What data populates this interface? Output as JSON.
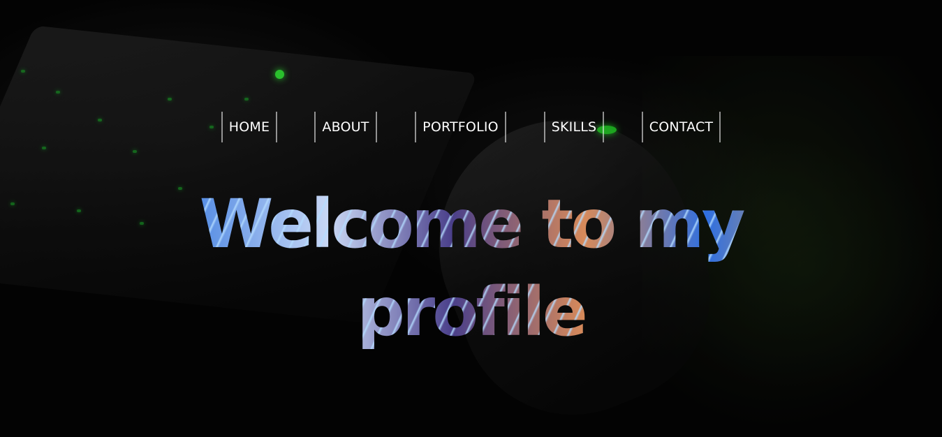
{
  "nav": {
    "items": [
      {
        "label": "HOME"
      },
      {
        "label": "ABOUT"
      },
      {
        "label": "PORTFOLIO"
      },
      {
        "label": "SKILLS"
      },
      {
        "label": "CONTACT"
      }
    ]
  },
  "hero": {
    "heading_line1": "Welcome to my",
    "heading_line2": "profile"
  },
  "colors": {
    "nav_text": "#ffffff",
    "nav_border": "#ffffff",
    "accent_green": "#39ff3c",
    "background": "#050505"
  }
}
